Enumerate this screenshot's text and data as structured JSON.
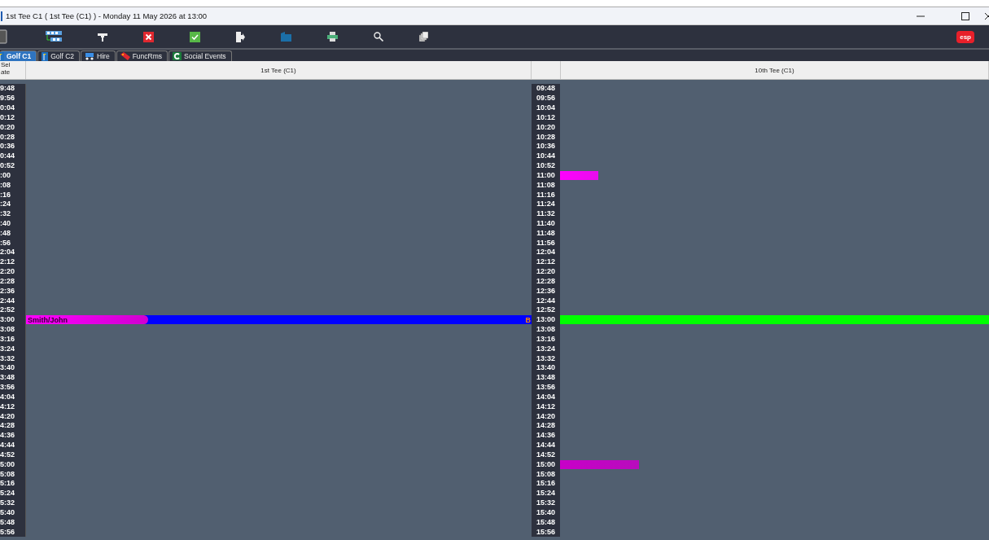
{
  "window": {
    "title": "1st Tee C1 ( 1st Tee (C1) )  - Monday 11 May 2026 at 13:00"
  },
  "toolbar": {
    "logo": "esp"
  },
  "tabs": [
    {
      "label": "Golf C1",
      "selected": true,
      "kind": "golf"
    },
    {
      "label": "Golf C2",
      "selected": false,
      "kind": "golf"
    },
    {
      "label": "Hire",
      "selected": false,
      "kind": "hire"
    },
    {
      "label": "FuncRms",
      "selected": false,
      "kind": "func"
    },
    {
      "label": "Social Events",
      "selected": false,
      "kind": "social"
    }
  ],
  "header": {
    "sel": "Sel",
    "date": "ate"
  },
  "columns": [
    {
      "title": "1st Tee (C1)"
    },
    {
      "title": "10th Tee (C1)"
    }
  ],
  "rows": [
    {
      "left": "9:48",
      "time": "09:48"
    },
    {
      "left": "9:56",
      "time": "09:56"
    },
    {
      "left": "0:04",
      "time": "10:04"
    },
    {
      "left": "0:12",
      "time": "10:12"
    },
    {
      "left": "0:20",
      "time": "10:20"
    },
    {
      "left": "0:28",
      "time": "10:28"
    },
    {
      "left": "0:36",
      "time": "10:36"
    },
    {
      "left": "0:44",
      "time": "10:44"
    },
    {
      "left": "0:52",
      "time": "10:52"
    },
    {
      "left": ":00",
      "time": "11:00",
      "tee10": {
        "kind": "short",
        "color": "#ff00ff"
      }
    },
    {
      "left": ":08",
      "time": "11:08"
    },
    {
      "left": ":16",
      "time": "11:16"
    },
    {
      "left": ":24",
      "time": "11:24"
    },
    {
      "left": ":32",
      "time": "11:32"
    },
    {
      "left": ":40",
      "time": "11:40"
    },
    {
      "left": ":48",
      "time": "11:48"
    },
    {
      "left": ":56",
      "time": "11:56"
    },
    {
      "left": "2:04",
      "time": "12:04"
    },
    {
      "left": "2:12",
      "time": "12:12"
    },
    {
      "left": "2:20",
      "time": "12:20"
    },
    {
      "left": "2:28",
      "time": "12:28"
    },
    {
      "left": "2:36",
      "time": "12:36"
    },
    {
      "left": "2:44",
      "time": "12:44"
    },
    {
      "left": "2:52",
      "time": "12:52"
    },
    {
      "left": "3:00",
      "time": "13:00",
      "tee1": {
        "kind": "full",
        "color": "#0000ff",
        "name": "Smith/John",
        "flag": "B"
      },
      "tee10": {
        "kind": "full",
        "color": "#00ff00"
      }
    },
    {
      "left": "3:08",
      "time": "13:08"
    },
    {
      "left": "3:16",
      "time": "13:16"
    },
    {
      "left": "3:24",
      "time": "13:24"
    },
    {
      "left": "3:32",
      "time": "13:32"
    },
    {
      "left": "3:40",
      "time": "13:40"
    },
    {
      "left": "3:48",
      "time": "13:48"
    },
    {
      "left": "3:56",
      "time": "13:56"
    },
    {
      "left": "4:04",
      "time": "14:04"
    },
    {
      "left": "4:12",
      "time": "14:12"
    },
    {
      "left": "4:20",
      "time": "14:20"
    },
    {
      "left": "4:28",
      "time": "14:28"
    },
    {
      "left": "4:36",
      "time": "14:36"
    },
    {
      "left": "4:44",
      "time": "14:44"
    },
    {
      "left": "4:52",
      "time": "14:52"
    },
    {
      "left": "5:00",
      "time": "15:00",
      "tee10": {
        "kind": "medium",
        "color": "#c800c8"
      }
    },
    {
      "left": "5:08",
      "time": "15:08"
    },
    {
      "left": "5:16",
      "time": "15:16"
    },
    {
      "left": "5:24",
      "time": "15:24"
    },
    {
      "left": "5:32",
      "time": "15:32"
    },
    {
      "left": "5:40",
      "time": "15:40"
    },
    {
      "left": "5:48",
      "time": "15:48"
    },
    {
      "left": "5:56",
      "time": "15:56"
    }
  ]
}
